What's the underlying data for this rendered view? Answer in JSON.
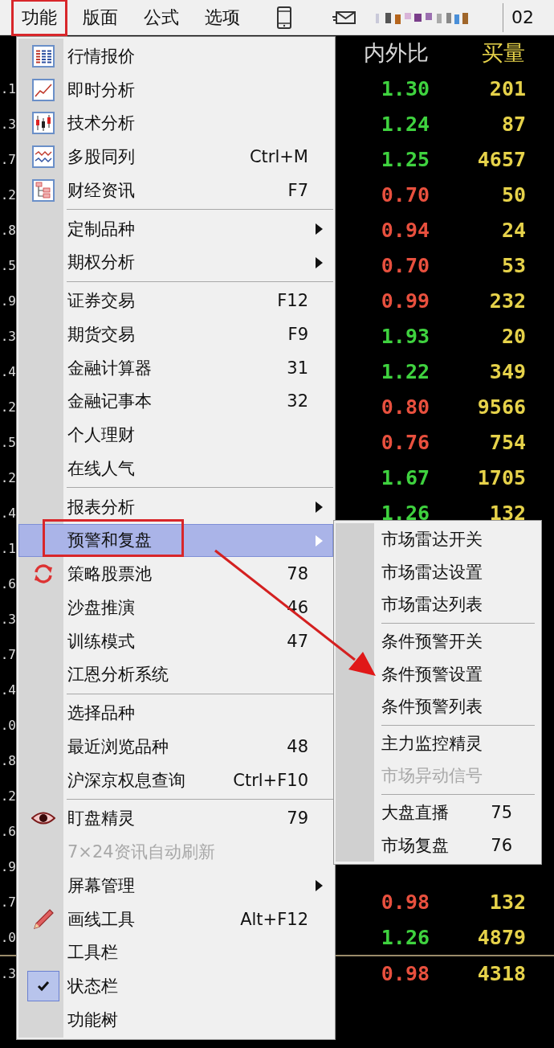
{
  "menubar": {
    "items": [
      {
        "label": "功能",
        "selected": true
      },
      {
        "label": "版面",
        "selected": false
      },
      {
        "label": "公式",
        "selected": false
      },
      {
        "label": "选项",
        "selected": false
      }
    ],
    "right_edge_text": "02"
  },
  "quotes": {
    "columns": [
      "内外比",
      "买量"
    ],
    "rows": [
      {
        "edge": ".1",
        "ratio": "1.30",
        "volume": "201",
        "color": "#3fd23f"
      },
      {
        "edge": ".3",
        "ratio": "1.24",
        "volume": "87",
        "color": "#3fd23f"
      },
      {
        "edge": ".7",
        "ratio": "1.25",
        "volume": "4657",
        "color": "#3fd23f"
      },
      {
        "edge": ".2",
        "ratio": "0.70",
        "volume": "50",
        "color": "#e8503e"
      },
      {
        "edge": ".8",
        "ratio": "0.94",
        "volume": "24",
        "color": "#e8503e"
      },
      {
        "edge": ".5",
        "ratio": "0.70",
        "volume": "53",
        "color": "#e8503e"
      },
      {
        "edge": ".9",
        "ratio": "0.99",
        "volume": "232",
        "color": "#e8503e"
      },
      {
        "edge": ".3",
        "ratio": "1.93",
        "volume": "20",
        "color": "#3fd23f"
      },
      {
        "edge": ".4",
        "ratio": "1.22",
        "volume": "349",
        "color": "#3fd23f"
      },
      {
        "edge": ".2",
        "ratio": "0.80",
        "volume": "9566",
        "color": "#e8503e"
      },
      {
        "edge": ".5",
        "ratio": "0.76",
        "volume": "754",
        "color": "#e8503e"
      },
      {
        "edge": ".2",
        "ratio": "1.67",
        "volume": "1705",
        "color": "#3fd23f"
      },
      {
        "edge": ".4",
        "ratio": "1.26",
        "volume": "132",
        "color": "#3fd23f"
      },
      {
        "edge": ".1"
      },
      {
        "edge": ".6"
      },
      {
        "edge": ".3"
      },
      {
        "edge": ".7"
      },
      {
        "edge": ".4"
      },
      {
        "edge": ".0"
      },
      {
        "edge": ".8"
      },
      {
        "edge": ".2"
      },
      {
        "edge": ".6"
      },
      {
        "edge": ".9"
      },
      {
        "edge": ".7",
        "ratio": "0.98",
        "volume": "132",
        "color": "#e8503e"
      },
      {
        "edge": ".0",
        "ratio": "1.26",
        "volume": "4879",
        "color": "#3fd23f"
      },
      {
        "edge": ".3",
        "ratio": "0.98",
        "volume": "4318",
        "color": "#e8503e",
        "divider_above": true
      }
    ]
  },
  "menu": {
    "items": [
      {
        "kind": "item",
        "label": "行情报价",
        "selected": false,
        "disabled": false,
        "checked": false,
        "has_submenu": false
      },
      {
        "kind": "item",
        "label": "即时分析",
        "selected": false,
        "disabled": false,
        "checked": false,
        "has_submenu": false
      },
      {
        "kind": "item",
        "label": "技术分析",
        "selected": false,
        "disabled": false,
        "checked": false,
        "has_submenu": false
      },
      {
        "kind": "item",
        "label": "多股同列",
        "shortcut": "Ctrl+M",
        "selected": false,
        "disabled": false,
        "checked": false,
        "has_submenu": false
      },
      {
        "kind": "item",
        "label": "财经资讯",
        "shortcut": "F7",
        "selected": false,
        "disabled": false,
        "checked": false,
        "has_submenu": false
      },
      {
        "kind": "separator"
      },
      {
        "kind": "item",
        "label": "定制品种",
        "selected": false,
        "disabled": false,
        "checked": false,
        "has_submenu": true
      },
      {
        "kind": "item",
        "label": "期权分析",
        "selected": false,
        "disabled": false,
        "checked": false,
        "has_submenu": true
      },
      {
        "kind": "separator"
      },
      {
        "kind": "item",
        "label": "证券交易",
        "shortcut": "F12",
        "selected": false,
        "disabled": false,
        "checked": false,
        "has_submenu": false
      },
      {
        "kind": "item",
        "label": "期货交易",
        "shortcut": "F9",
        "selected": false,
        "disabled": false,
        "checked": false,
        "has_submenu": false
      },
      {
        "kind": "item",
        "label": "金融计算器",
        "shortcut": "31",
        "selected": false,
        "disabled": false,
        "checked": false,
        "has_submenu": false
      },
      {
        "kind": "item",
        "label": "金融记事本",
        "shortcut": "32",
        "selected": false,
        "disabled": false,
        "checked": false,
        "has_submenu": false
      },
      {
        "kind": "item",
        "label": "个人理财",
        "selected": false,
        "disabled": false,
        "checked": false,
        "has_submenu": false
      },
      {
        "kind": "item",
        "label": "在线人气",
        "selected": false,
        "disabled": false,
        "checked": false,
        "has_submenu": false
      },
      {
        "kind": "separator"
      },
      {
        "kind": "item",
        "label": "报表分析",
        "selected": false,
        "disabled": false,
        "checked": false,
        "has_submenu": true
      },
      {
        "kind": "item",
        "label": "预警和复盘",
        "selected": true,
        "disabled": false,
        "checked": false,
        "has_submenu": true
      },
      {
        "kind": "item",
        "label": "策略股票池",
        "shortcut": "78",
        "selected": false,
        "disabled": false,
        "checked": false,
        "has_submenu": false
      },
      {
        "kind": "item",
        "label": "沙盘推演",
        "shortcut": "46",
        "selected": false,
        "disabled": false,
        "checked": false,
        "has_submenu": false
      },
      {
        "kind": "item",
        "label": "训练模式",
        "shortcut": "47",
        "selected": false,
        "disabled": false,
        "checked": false,
        "has_submenu": false
      },
      {
        "kind": "item",
        "label": "江恩分析系统",
        "selected": false,
        "disabled": false,
        "checked": false,
        "has_submenu": false
      },
      {
        "kind": "separator"
      },
      {
        "kind": "item",
        "label": "选择品种",
        "selected": false,
        "disabled": false,
        "checked": false,
        "has_submenu": false
      },
      {
        "kind": "item",
        "label": "最近浏览品种",
        "shortcut": "48",
        "selected": false,
        "disabled": false,
        "checked": false,
        "has_submenu": false
      },
      {
        "kind": "item",
        "label": "沪深京权息查询",
        "shortcut": "Ctrl+F10",
        "selected": false,
        "disabled": false,
        "checked": false,
        "has_submenu": false
      },
      {
        "kind": "separator"
      },
      {
        "kind": "item",
        "label": "盯盘精灵",
        "shortcut": "79",
        "selected": false,
        "disabled": false,
        "checked": false,
        "has_submenu": false
      },
      {
        "kind": "item",
        "label": "7×24资讯自动刷新",
        "selected": false,
        "disabled": true,
        "checked": false,
        "has_submenu": false
      },
      {
        "kind": "item",
        "label": "屏幕管理",
        "selected": false,
        "disabled": false,
        "checked": false,
        "has_submenu": true
      },
      {
        "kind": "item",
        "label": "画线工具",
        "shortcut": "Alt+F12",
        "selected": false,
        "disabled": false,
        "checked": false,
        "has_submenu": false
      },
      {
        "kind": "item",
        "label": "工具栏",
        "selected": false,
        "disabled": false,
        "checked": false,
        "has_submenu": false
      },
      {
        "kind": "item",
        "label": "状态栏",
        "selected": false,
        "disabled": false,
        "checked": true,
        "has_submenu": false
      },
      {
        "kind": "item",
        "label": "功能树",
        "selected": false,
        "disabled": false,
        "checked": false,
        "has_submenu": false
      }
    ]
  },
  "submenu": {
    "items": [
      {
        "kind": "item",
        "label": "市场雷达开关",
        "disabled": false
      },
      {
        "kind": "item",
        "label": "市场雷达设置",
        "disabled": false
      },
      {
        "kind": "item",
        "label": "市场雷达列表",
        "disabled": false
      },
      {
        "kind": "separator"
      },
      {
        "kind": "item",
        "label": "条件预警开关",
        "disabled": false
      },
      {
        "kind": "item",
        "label": "条件预警设置",
        "disabled": false
      },
      {
        "kind": "item",
        "label": "条件预警列表",
        "disabled": false
      },
      {
        "kind": "separator"
      },
      {
        "kind": "item",
        "label": "主力监控精灵",
        "disabled": false
      },
      {
        "kind": "item",
        "label": "市场异动信号",
        "disabled": true
      },
      {
        "kind": "separator"
      },
      {
        "kind": "item",
        "label": "大盘直播",
        "shortcut": "75",
        "disabled": false
      },
      {
        "kind": "item",
        "label": "市场复盘",
        "shortcut": "76",
        "disabled": false
      }
    ]
  }
}
